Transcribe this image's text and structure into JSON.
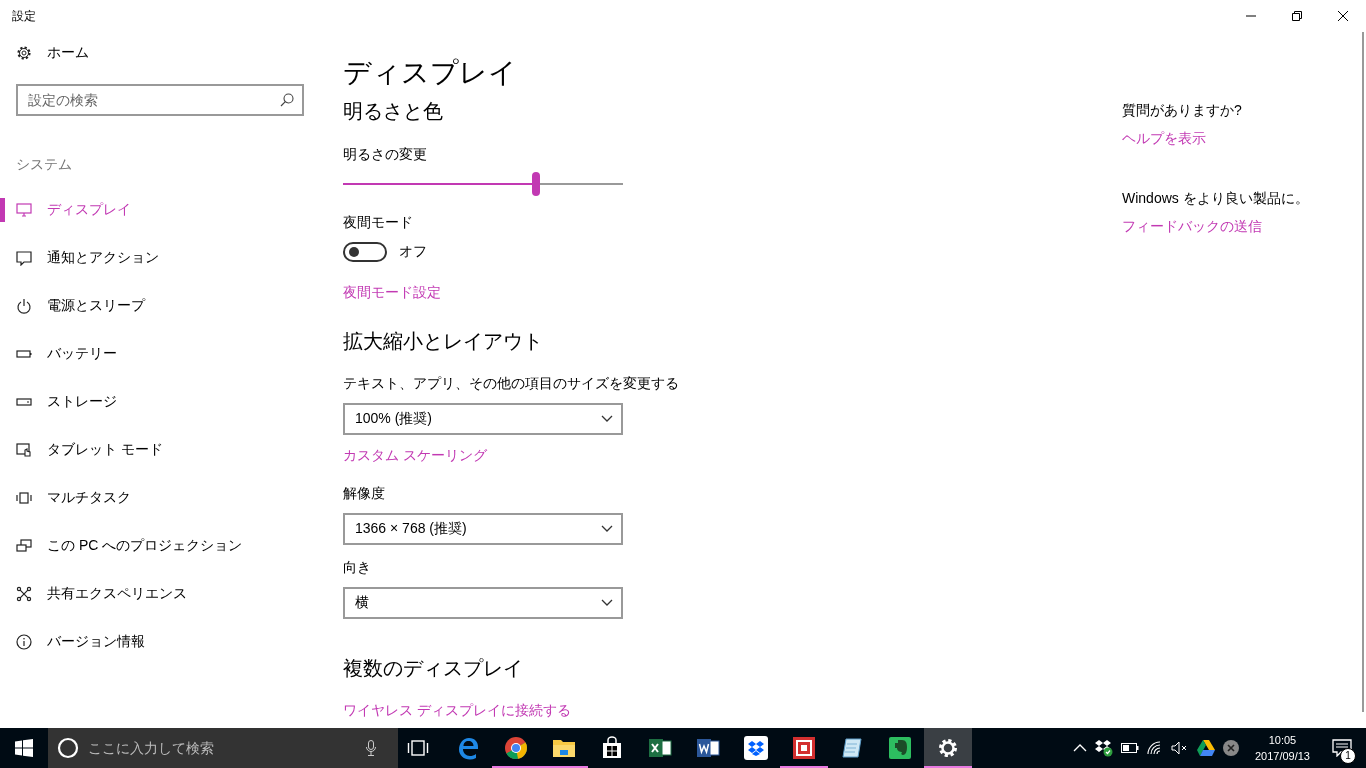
{
  "window": {
    "title": "設定"
  },
  "sidebar": {
    "home": {
      "label": "ホーム"
    },
    "search": {
      "placeholder": "設定の検索"
    },
    "section": "システム",
    "items": [
      {
        "kind": "display",
        "label": "ディスプレイ",
        "selected": true
      },
      {
        "kind": "notification",
        "label": "通知とアクション",
        "selected": false
      },
      {
        "kind": "power",
        "label": "電源とスリープ",
        "selected": false
      },
      {
        "kind": "battery",
        "label": "バッテリー",
        "selected": false
      },
      {
        "kind": "storage",
        "label": "ストレージ",
        "selected": false
      },
      {
        "kind": "tablet",
        "label": "タブレット モード",
        "selected": false
      },
      {
        "kind": "multitask",
        "label": "マルチタスク",
        "selected": false
      },
      {
        "kind": "project",
        "label": "この PC へのプロジェクション",
        "selected": false
      },
      {
        "kind": "share",
        "label": "共有エクスペリエンス",
        "selected": false
      },
      {
        "kind": "info",
        "label": "バージョン情報",
        "selected": false
      }
    ]
  },
  "page_title": "ディスプレイ",
  "brightness_color": {
    "heading": "明るさと色",
    "brightness": {
      "label": "明るさの変更",
      "level": 0.69
    },
    "night_light": {
      "label": "夜間モード",
      "on": false,
      "state_text": "オフ"
    },
    "link": "夜間モード設定"
  },
  "scale_layout": {
    "heading": "拡大縮小とレイアウト",
    "scale": {
      "label": "テキスト、アプリ、その他の項目のサイズを変更する",
      "value": "100% (推奨)"
    },
    "link": "カスタム スケーリング",
    "resolution": {
      "label": "解像度",
      "value": "1366 × 768 (推奨)"
    },
    "orientation": {
      "label": "向き",
      "value": "横"
    }
  },
  "multiple_displays": {
    "heading": "複数のディスプレイ",
    "link": "ワイヤレス ディスプレイに接続する"
  },
  "help": [
    {
      "text": "質問がありますか?",
      "link": "ヘルプを表示"
    },
    {
      "text": "Windows をより良い製品に。",
      "link": "フィードバックの送信"
    }
  ],
  "taskbar": {
    "search_placeholder": "ここに入力して検索",
    "apps": [
      {
        "kind": "edge",
        "running": false,
        "selected": false
      },
      {
        "kind": "chrome",
        "running": true,
        "selected": false
      },
      {
        "kind": "explorer",
        "running": true,
        "selected": false
      },
      {
        "kind": "store",
        "running": false,
        "selected": false
      },
      {
        "kind": "excel",
        "running": false,
        "selected": false
      },
      {
        "kind": "word",
        "running": false,
        "selected": false
      },
      {
        "kind": "dropbox",
        "running": false,
        "selected": false
      },
      {
        "kind": "red-app",
        "running": true,
        "selected": false
      },
      {
        "kind": "notepad",
        "running": false,
        "selected": false
      },
      {
        "kind": "evernote",
        "running": false,
        "selected": false
      },
      {
        "kind": "settings",
        "running": true,
        "selected": true
      }
    ],
    "time": "10:05",
    "date": "2017/09/13",
    "notification_count": "1"
  }
}
